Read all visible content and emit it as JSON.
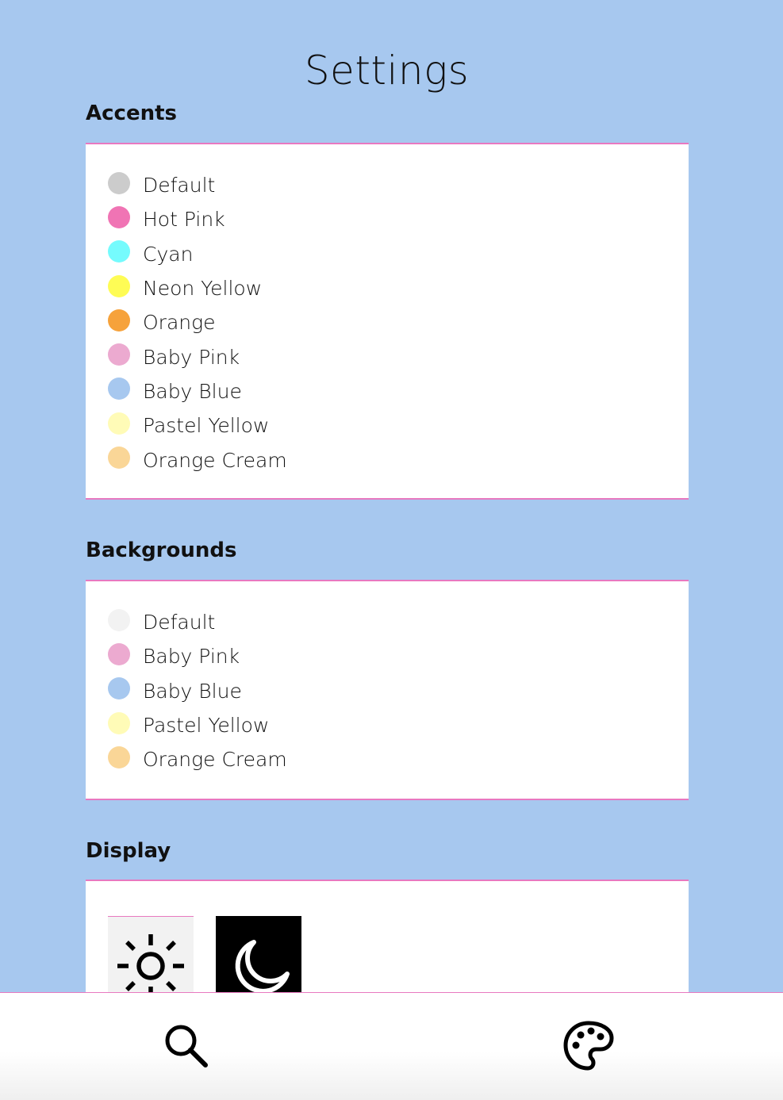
{
  "page": {
    "title": "Settings"
  },
  "accents": {
    "title": "Accents",
    "options": [
      {
        "label": "Default",
        "color": "#cccccc"
      },
      {
        "label": "Hot Pink",
        "color": "#f074b4"
      },
      {
        "label": "Cyan",
        "color": "#75fbfd"
      },
      {
        "label": "Neon Yellow",
        "color": "#fefc55"
      },
      {
        "label": "Orange",
        "color": "#f6a23b"
      },
      {
        "label": "Baby Pink",
        "color": "#ecaad0"
      },
      {
        "label": "Baby Blue",
        "color": "#a7c8ef"
      },
      {
        "label": "Pastel Yellow",
        "color": "#fffbb7"
      },
      {
        "label": "Orange Cream",
        "color": "#fad697"
      }
    ]
  },
  "backgrounds": {
    "title": "Backgrounds",
    "options": [
      {
        "label": "Default",
        "color": "#f2f2f2"
      },
      {
        "label": "Baby Pink",
        "color": "#ecaad0"
      },
      {
        "label": "Baby Blue",
        "color": "#a7c8ef"
      },
      {
        "label": "Pastel Yellow",
        "color": "#fffbb7"
      },
      {
        "label": "Orange Cream",
        "color": "#fad697"
      }
    ]
  },
  "display": {
    "title": "Display",
    "modes": [
      {
        "icon": "sun-icon",
        "background": "#f2f2f2"
      },
      {
        "icon": "moon-icon",
        "background": "#000000"
      }
    ]
  },
  "bottom_bar": {
    "items": [
      {
        "icon": "search-icon"
      },
      {
        "icon": "palette-icon"
      }
    ]
  },
  "colors": {
    "page_background": "#a7c8ef",
    "divider_accent": "#e879c0",
    "panel_background": "#ffffff"
  }
}
